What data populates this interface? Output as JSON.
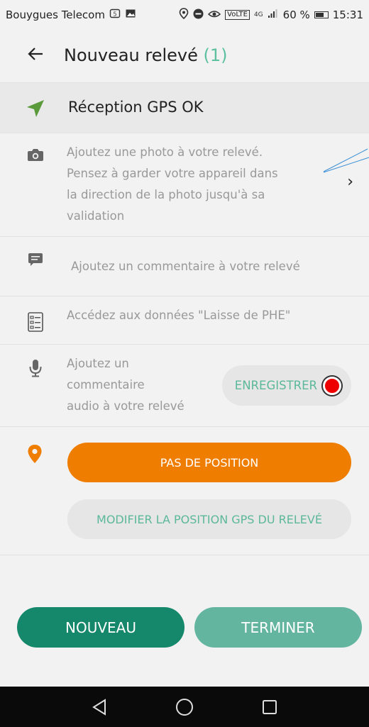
{
  "status_bar": {
    "carrier": "Bouygues Telecom",
    "volte": "VoLTE",
    "network": "4G",
    "battery": "60 %",
    "time": "15:31"
  },
  "header": {
    "title": "Nouveau relevé",
    "count": "(1)"
  },
  "gps": {
    "label": "Réception GPS OK",
    "icon": "navigation-arrow-icon",
    "icon_color": "#5a9a3a"
  },
  "photo": {
    "lines": [
      "Ajoutez une photo à votre relevé.",
      "Pensez à garder votre appareil dans",
      "la direction de la photo jusqu'à sa",
      "validation"
    ],
    "icon": "camera-icon",
    "chevron": "›"
  },
  "comment": {
    "label": "Ajoutez un commentaire à votre relevé",
    "icon": "comment-icon"
  },
  "phe": {
    "label": "Accédez aux données \"Laisse de PHE\"",
    "icon": "list-icon"
  },
  "audio": {
    "lines": [
      "Ajoutez un",
      "commentaire",
      "audio à votre relevé"
    ],
    "record_label": "ENREGISTRER",
    "icon": "microphone-icon"
  },
  "position": {
    "icon": "location-pin-icon",
    "no_position_label": "PAS DE POSITION",
    "modify_label": "MODIFIER LA POSITION GPS DU RELEVÉ"
  },
  "footer": {
    "new_label": "NOUVEAU",
    "finish_label": "TERMINER"
  },
  "colors": {
    "accent_green": "#15876a",
    "light_green": "#64b5a0",
    "text_green": "#5bb89a",
    "orange": "#ef7d00",
    "record_red": "#e00000"
  }
}
